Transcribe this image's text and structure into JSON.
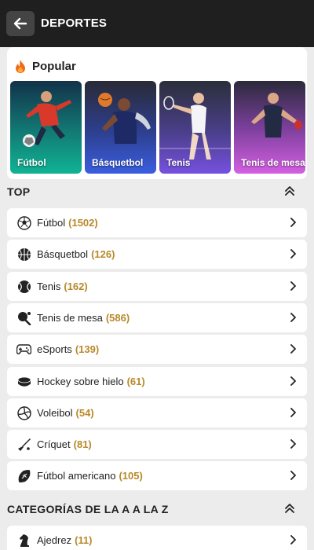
{
  "header": {
    "title": "DEPORTES",
    "back_icon": "arrow-left-icon"
  },
  "popular": {
    "title": "Popular",
    "icon": "fire-icon",
    "tiles": [
      {
        "label": "Fútbol",
        "color": "#10a98f"
      },
      {
        "label": "Básquetbol",
        "color": "#3658d6"
      },
      {
        "label": "Tenis",
        "color": "#6b4fd8"
      },
      {
        "label": "Tenis de mesa",
        "color": "#c35bd8"
      }
    ]
  },
  "top": {
    "title": "TOP",
    "items": [
      {
        "name": "Fútbol",
        "count": "(1502)",
        "icon": "soccer-ball-icon"
      },
      {
        "name": "Básquetbol",
        "count": "(126)",
        "icon": "basketball-icon"
      },
      {
        "name": "Tenis",
        "count": "(162)",
        "icon": "tennis-ball-icon"
      },
      {
        "name": "Tenis de mesa",
        "count": "(586)",
        "icon": "ping-pong-icon"
      },
      {
        "name": "eSports",
        "count": "(139)",
        "icon": "gamepad-icon"
      },
      {
        "name": "Hockey sobre hielo",
        "count": "(61)",
        "icon": "hockey-puck-icon"
      },
      {
        "name": "Voleibol",
        "count": "(54)",
        "icon": "volleyball-icon"
      },
      {
        "name": "Críquet",
        "count": "(81)",
        "icon": "cricket-bat-icon"
      },
      {
        "name": "Fútbol americano",
        "count": "(105)",
        "icon": "american-football-icon"
      }
    ]
  },
  "categories": {
    "title": "CATEGORÍAS DE LA A A LA Z",
    "items": [
      {
        "name": "Ajedrez",
        "count": "(11)",
        "icon": "chess-knight-icon"
      }
    ]
  },
  "colors": {
    "count": "#b7892a",
    "topbar": "#1f1f1f",
    "background": "#ececec"
  }
}
